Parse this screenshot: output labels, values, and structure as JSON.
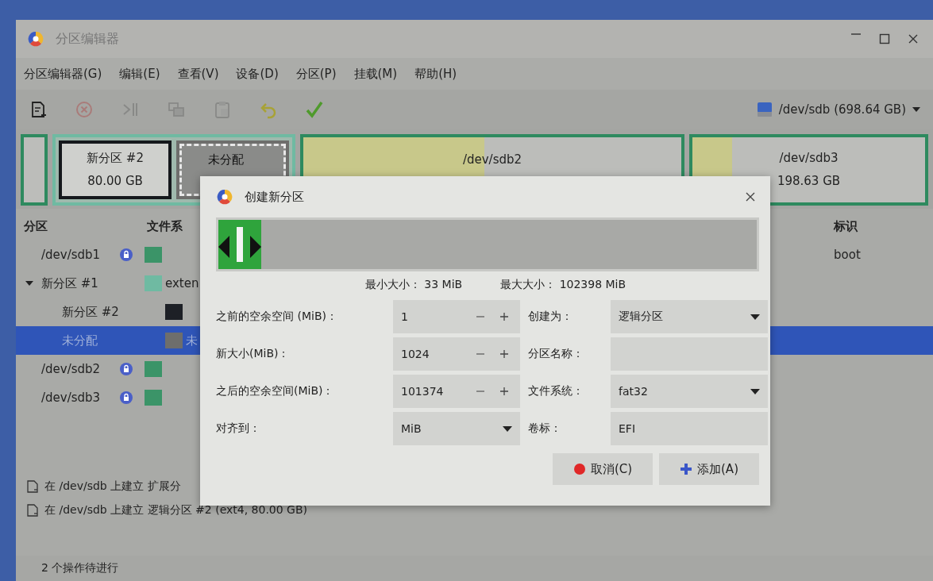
{
  "window": {
    "title": "分区编辑器"
  },
  "menu": [
    "分区编辑器(G)",
    "编辑(E)",
    "查看(V)",
    "设备(D)",
    "分区(P)",
    "挂载(M)",
    "帮助(H)"
  ],
  "toolbar": [
    {
      "kind": "new",
      "disabled": false
    },
    {
      "kind": "delete",
      "disabled": true
    },
    {
      "kind": "resize",
      "disabled": true
    },
    {
      "kind": "copy",
      "disabled": true
    },
    {
      "kind": "paste",
      "disabled": true
    },
    {
      "kind": "undo",
      "disabled": false
    },
    {
      "kind": "apply",
      "disabled": false
    }
  ],
  "device": {
    "label": "/dev/sdb (698.64 GB)"
  },
  "disk_map": [
    {
      "kind": "partition",
      "color": "#2e8a5f",
      "selected": false
    },
    {
      "kind": "extended",
      "color": "#6fbaa2",
      "selected": false,
      "children": [
        {
          "kind": "partition",
          "name": "新分区 #2",
          "size": "80.00 GB",
          "color": "#15181c",
          "selected": false
        },
        {
          "kind": "unallocated",
          "name": "未分配",
          "color": "#6e6e6c",
          "selected": true
        }
      ]
    },
    {
      "kind": "partition",
      "name": "/dev/sdb2",
      "color": "#2e8a5f",
      "level": 0.48,
      "selected": false
    },
    {
      "kind": "partition",
      "name": "/dev/sdb3",
      "size": "198.63 GB",
      "color": "#2e8a5f",
      "level": 0.17,
      "selected": false
    }
  ],
  "partition_table": {
    "columns": [
      "分区",
      "文件系",
      "标识"
    ],
    "rows": [
      {
        "name": "/dev/sdb1",
        "mounted": true,
        "color": "#3b9468",
        "flags": "boot",
        "selected": false
      },
      {
        "name": "新分区 #1",
        "mounted": false,
        "color": "#6fbaa2",
        "filesystem": "exten",
        "selected": false,
        "expanded": true,
        "children": [
          {
            "name": "新分区 #2",
            "mounted": false,
            "color": "#1d2026",
            "selected": false
          },
          {
            "name": "未分配",
            "mounted": false,
            "color": "#6e6e6c",
            "filesystem": "未",
            "selected": true
          }
        ]
      },
      {
        "name": "/dev/sdb2",
        "mounted": true,
        "color": "#3b9468",
        "selected": false
      },
      {
        "name": "/dev/sdb3",
        "mounted": true,
        "color": "#3b9468",
        "selected": false
      }
    ]
  },
  "operations": [
    "在 /dev/sdb 上建立 扩展分",
    "在 /dev/sdb 上建立 逻辑分区 #2 (ext4, 80.00 GB)"
  ],
  "status_bar": "2 个操作待进行",
  "dialog": {
    "title": "创建新分区",
    "level": 0.08,
    "limits": [
      "最小大小： 33 MiB",
      "最大大小： 102398 MiB"
    ],
    "form": [
      {
        "label": "之前的空余空间 (MiB)：",
        "kind": "spin",
        "value": "1"
      },
      {
        "label": "创建为：",
        "kind": "select",
        "value": "逻辑分区"
      },
      {
        "label": "新大小(MiB)：",
        "kind": "spin",
        "value": "1024"
      },
      {
        "label": "分区名称：",
        "kind": "text"
      },
      {
        "label": "之后的空余空间(MiB)：",
        "kind": "spin",
        "value": "101374"
      },
      {
        "label": "文件系统：",
        "kind": "select",
        "value": "fat32"
      },
      {
        "label": "对齐到：",
        "kind": "select",
        "value": "MiB"
      },
      {
        "label": "卷标：",
        "kind": "text",
        "value": "EFI"
      }
    ],
    "buttons": [
      {
        "label": "取消(C)",
        "kind": "cancel"
      },
      {
        "label": "添加(A)",
        "kind": "add"
      }
    ]
  }
}
